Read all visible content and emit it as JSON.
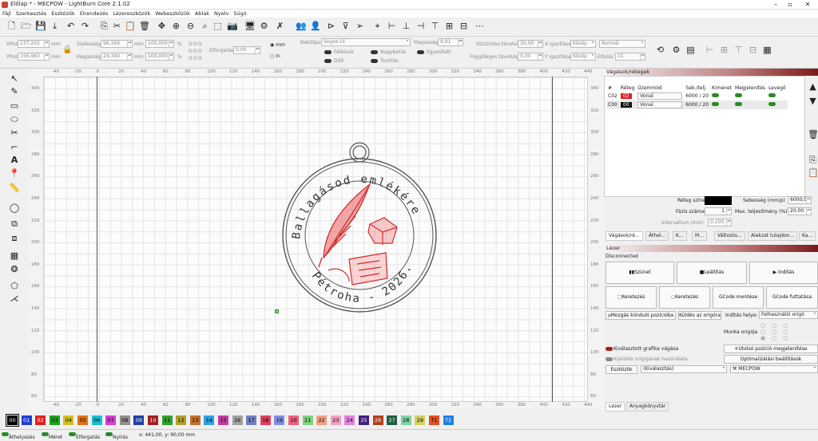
{
  "window": {
    "title": "Előlap * - MECPOW - LightBurn Core 2.1.02"
  },
  "menu": [
    "Fájl",
    "Szerkesztés",
    "Eszközök",
    "Elrendezés",
    "Lézereszközök",
    "Webeszközök",
    "Ablak",
    "Nyelv",
    "Súgó"
  ],
  "props": {
    "xpos_label": "XPoz",
    "xpos": "237,202",
    "ypos_label": "YPoz",
    "ypos": "156,963",
    "unit": "mm",
    "width_label": "Szélesség",
    "width": "96,359",
    "height_label": "Magasság",
    "height": "24,340",
    "scale_w": "100,000",
    "scale_h": "100,000",
    "percent": "%",
    "rotate_label": "Elforgatás",
    "rotate": "0,00",
    "unit_mm": "mm",
    "unit_in": "in",
    "font_label": "Betűtípus",
    "font": "Segoe UI",
    "fheight_label": "Magasság",
    "fheight": "9,91",
    "bold": "Félkövér",
    "italic": "Dőlt",
    "caps": "Nagybetűs",
    "weld": "Egyesített",
    "distort": "Torzítás",
    "hspace_label": "Vízszintes távolság",
    "hspace": "30,00",
    "halign_label": "X igazítása",
    "halign": "Közép",
    "vspace_label": "Függőleges távolság",
    "vspace": "0,00",
    "valign_label": "Y igazítása",
    "valign": "Közép",
    "style": "Normál",
    "offset_label": "Eltolás",
    "offset": "11"
  },
  "ruler": {
    "top": [
      "-40",
      "-20",
      "0",
      "20",
      "40",
      "60",
      "80",
      "100",
      "120",
      "140",
      "160",
      "180",
      "200",
      "220",
      "240",
      "260",
      "280",
      "300",
      "320",
      "340",
      "360",
      "380",
      "400",
      "420",
      "440"
    ],
    "left": [
      "340",
      "320",
      "300",
      "280",
      "260",
      "240",
      "220",
      "200",
      "180",
      "160",
      "140",
      "120",
      "100",
      "80",
      "60"
    ]
  },
  "design": {
    "top_text": "Ballagásod emlékére",
    "bottom_text": "Pétroha - 2026."
  },
  "layers_panel": {
    "title": "Vágások/rétegek",
    "headers": [
      "#",
      "Réteg",
      "Üzemmód",
      "Seb./telj.",
      "Kimenet",
      "Megjelenítés",
      "Levegő"
    ],
    "rows": [
      {
        "id": "C02",
        "layer": "02",
        "mode": "Vonal",
        "speed": "6000 / 20",
        "color": "#e02020"
      },
      {
        "id": "C00",
        "layer": "00",
        "mode": "Vonal",
        "speed": "6000 / 20",
        "color": "#111111"
      }
    ],
    "layer_color_label": "Réteg színe",
    "speed_label": "Sebesség (mm/p)",
    "speed": "6000,0",
    "passes_label": "Fázis száma",
    "passes": "1",
    "maxpower_label": "Max. teljesítmény (%)",
    "maxpower": "20,00",
    "interval_label": "Intervallum (mm)",
    "interval": "0,100",
    "tabs": [
      "Vágások/ré...",
      "Áthel...",
      "K...",
      "M...",
      "Változós...",
      "Alakzat tulajdon...",
      "Ka..."
    ]
  },
  "laser_panel": {
    "title": "Lézer",
    "status": "Disconnected",
    "pause": "Szünet",
    "stop": "Leállítás",
    "start": "Indítás",
    "frame1": "Keretezés",
    "frame2": "Keretezés",
    "save_gcode": "GCode mentése",
    "run_gcode": "GCode futtatása",
    "home": "Mozgás kiinduló pozícióba",
    "goto_origin": "Küldés az origóra",
    "start_from_label": "Indítás helye:",
    "start_from": "Felhasználói origó",
    "job_origin_label": "Munka origója",
    "cut_selected": "Kiválasztott grafika vágása",
    "use_origin": "Kijelölés origójának használata",
    "show_last": "Utolsó pozíció megjelenítése",
    "opt_settings": "Optimalizálási beállítások",
    "devices": "Eszközök",
    "selection": "(Kiválasztás)",
    "device": "MECPOW",
    "tab_laser": "Lézer",
    "tab_library": "Anyagkönyvtár"
  },
  "palette": [
    {
      "l": "00",
      "c": "#000000",
      "t": "#ffffff"
    },
    {
      "l": "01",
      "c": "#1f3fd0",
      "t": "#ffffff"
    },
    {
      "l": "02",
      "c": "#e02020",
      "t": "#ffffff"
    },
    {
      "l": "03",
      "c": "#20a020",
      "t": "#000000"
    },
    {
      "l": "04",
      "c": "#d0c020",
      "t": "#000000"
    },
    {
      "l": "05",
      "c": "#e07020",
      "t": "#000000"
    },
    {
      "l": "06",
      "c": "#20c0d0",
      "t": "#000000"
    },
    {
      "l": "07",
      "c": "#d040d0",
      "t": "#000000"
    },
    {
      "l": "08",
      "c": "#909090",
      "t": "#000000"
    },
    {
      "l": "09",
      "c": "#2040a0",
      "t": "#ffffff"
    },
    {
      "l": "10",
      "c": "#a02020",
      "t": "#ffffff"
    },
    {
      "l": "11",
      "c": "#30a030",
      "t": "#000000"
    },
    {
      "l": "12",
      "c": "#b0a030",
      "t": "#000000"
    },
    {
      "l": "13",
      "c": "#c07030",
      "t": "#000000"
    },
    {
      "l": "14",
      "c": "#30a0e0",
      "t": "#000000"
    },
    {
      "l": "15",
      "c": "#c040a0",
      "t": "#000000"
    },
    {
      "l": "16",
      "c": "#a0a0a0",
      "t": "#000000"
    },
    {
      "l": "17",
      "c": "#7080c0",
      "t": "#000000"
    },
    {
      "l": "18",
      "c": "#e04060",
      "t": "#000000"
    },
    {
      "l": "19",
      "c": "#8090e0",
      "t": "#000000"
    },
    {
      "l": "20",
      "c": "#f06080",
      "t": "#000000"
    },
    {
      "l": "21",
      "c": "#80d080",
      "t": "#000000"
    },
    {
      "l": "22",
      "c": "#f0a080",
      "t": "#000000"
    },
    {
      "l": "23",
      "c": "#f0a0c0",
      "t": "#000000"
    },
    {
      "l": "24",
      "c": "#e080e0",
      "t": "#000000"
    },
    {
      "l": "25",
      "c": "#402080",
      "t": "#ffffff"
    },
    {
      "l": "26",
      "c": "#b04020",
      "t": "#ffffff"
    },
    {
      "l": "27",
      "c": "#206040",
      "t": "#ffffff"
    },
    {
      "l": "28",
      "c": "#80d0a0",
      "t": "#000000"
    },
    {
      "l": "29",
      "c": "#d0d060",
      "t": "#000000"
    },
    {
      "l": "T1",
      "c": "#e05020",
      "t": "#000000"
    },
    {
      "l": "T2",
      "c": "#2080e0",
      "t": "#ffffff"
    }
  ],
  "status": {
    "move": "Áthelyezés",
    "size": "Méret",
    "rotate": "Elforgatás",
    "shear": "Nyírás",
    "coords": "x: 441,00, y: 90,00 mm"
  }
}
